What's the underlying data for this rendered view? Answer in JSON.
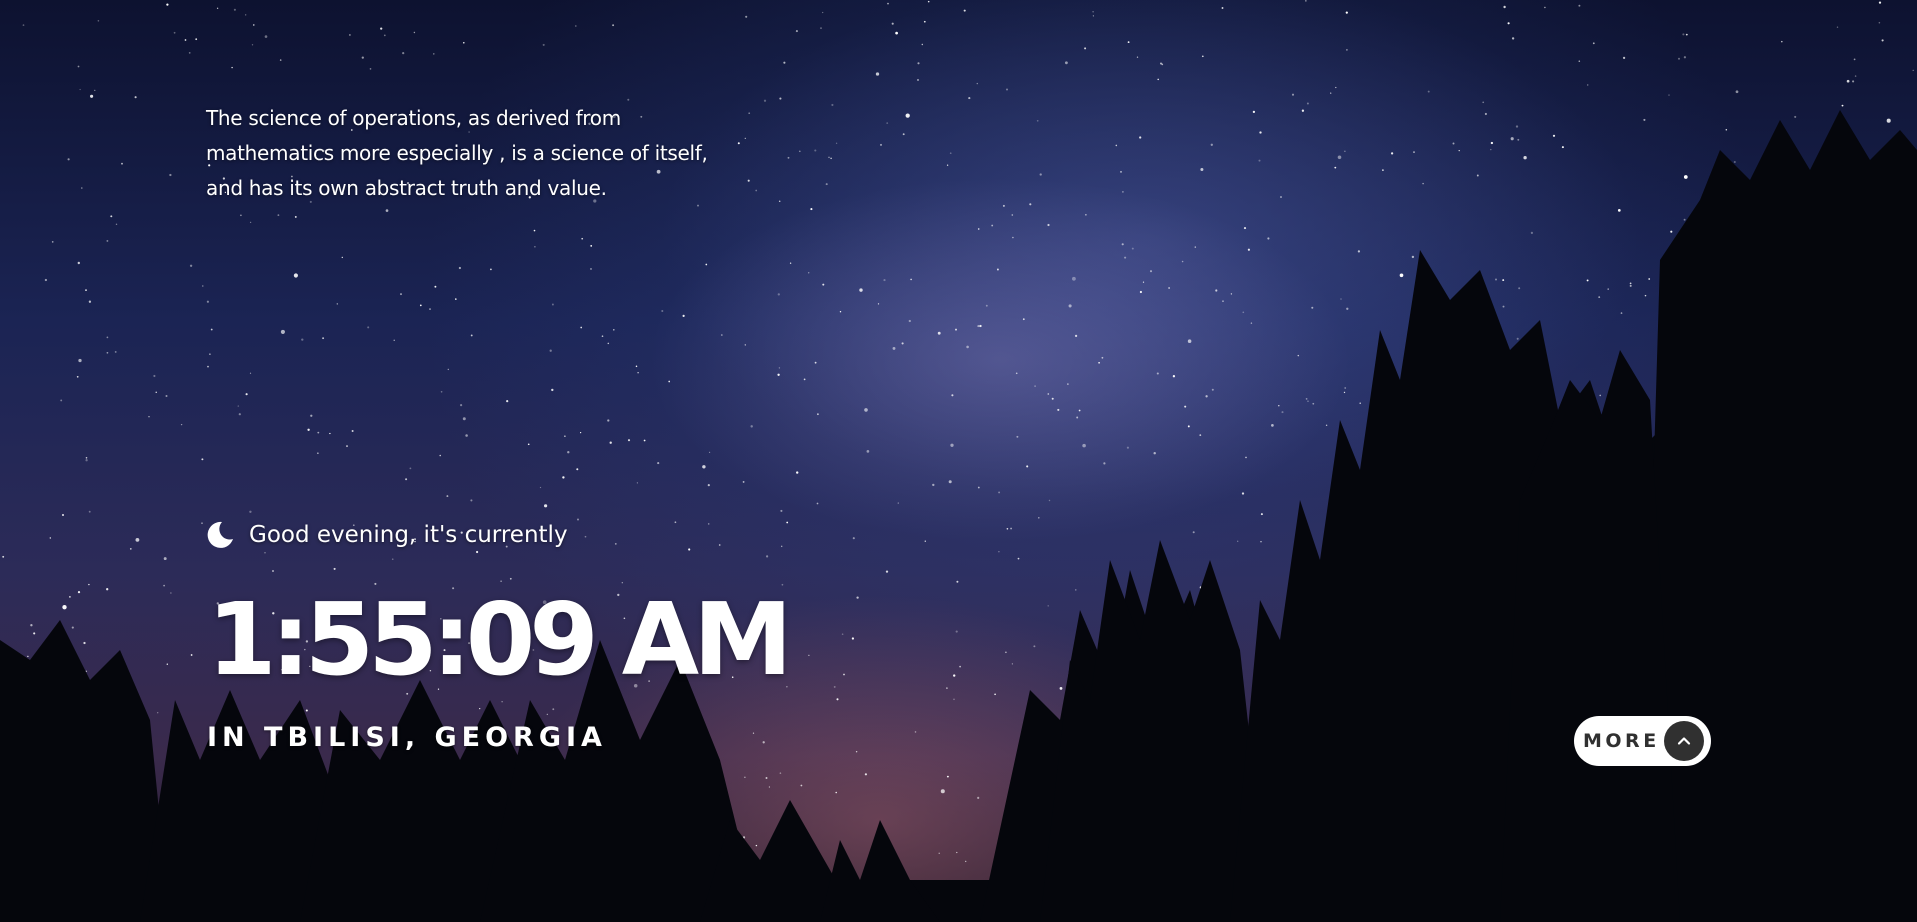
{
  "quote": {
    "text": "The science of operations, as derived from mathematics more especially , is a science of itself, and has its own abstract truth and value."
  },
  "greeting": {
    "icon": "moon-icon",
    "text": "Good evening, it's currently"
  },
  "clock": {
    "time": "1:55:09 AM"
  },
  "location": {
    "text": "IN TBILISI, GEORGIA"
  },
  "more_button": {
    "label": "MORE",
    "icon": "chevron-up-icon"
  },
  "colors": {
    "text": "#ffffff",
    "button_bg": "#ffffff",
    "button_text": "#303030",
    "button_icon_bg": "#303030"
  }
}
